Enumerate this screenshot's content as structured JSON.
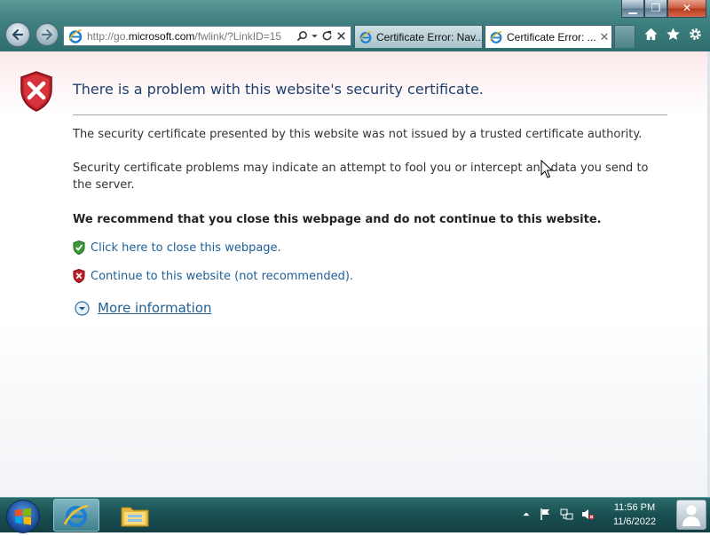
{
  "window": {
    "minimize_glyph": "▁",
    "maximize_glyph": "❐",
    "close_glyph": "✕"
  },
  "addressbar": {
    "url_prefix": "http://go.",
    "url_domain": "microsoft.com",
    "url_suffix": "/fwlink/?LinkID=15",
    "icon": "ie-icon"
  },
  "tabs": [
    {
      "label": "Certificate Error: Nav...",
      "active": false
    },
    {
      "label": "Certificate Error: ...",
      "active": true,
      "close_glyph": "✕"
    }
  ],
  "toolbar_icons": [
    "home-icon",
    "favorites-star-icon",
    "settings-gear-icon"
  ],
  "page": {
    "title": "There is a problem with this website's security certificate.",
    "para1": "The security certificate presented by this website was not issued by a trusted certificate authority.",
    "para2": "Security certificate problems may indicate an attempt to fool you or intercept any data you send to the server.",
    "recommend": "We recommend that you close this webpage and do not continue to this website.",
    "close_link": "Click here to close this webpage.",
    "continue_link": "Continue to this website (not recommended).",
    "more_info": "More information"
  },
  "colors": {
    "link": "#1e5f96",
    "title": "#1f3f6f",
    "shield_red": "#c0202a",
    "shield_green": "#3a9a3a"
  },
  "taskbar": {
    "time": "11:56 PM",
    "date": "11/6/2022",
    "pinned": [
      "internet-explorer-icon",
      "windows-explorer-icon"
    ],
    "tray_icons": [
      "show-hidden-icons-icon",
      "action-center-flag-icon",
      "network-icon",
      "volume-muted-icon"
    ]
  }
}
